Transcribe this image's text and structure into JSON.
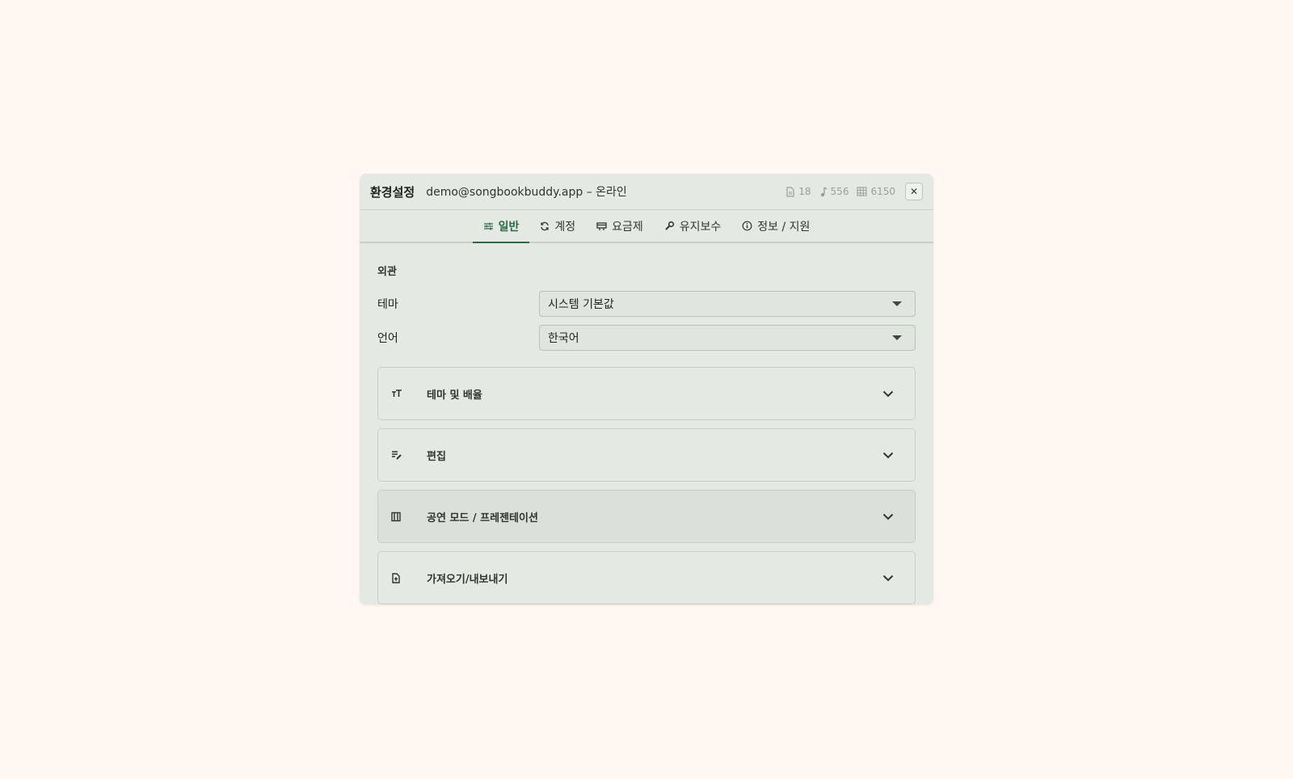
{
  "dialog": {
    "title": "환경설정",
    "subtitle": "demo@songbookbuddy.app – 온라인",
    "stats": [
      {
        "icon": "document-icon",
        "value": "18"
      },
      {
        "icon": "music-note-icon",
        "value": "556"
      },
      {
        "icon": "grid-icon",
        "value": "6150"
      }
    ],
    "close_label": "✕"
  },
  "tabs": [
    {
      "label": "일반",
      "icon": "sliders-icon",
      "active": true
    },
    {
      "label": "계정",
      "icon": "sync-icon",
      "active": false
    },
    {
      "label": "요금제",
      "icon": "billing-icon",
      "active": false
    },
    {
      "label": "유지보수",
      "icon": "wrench-icon",
      "active": false
    },
    {
      "label": "정보 / 지원",
      "icon": "info-icon",
      "active": false
    }
  ],
  "appearance": {
    "section_label": "외관",
    "theme_label": "테마",
    "theme_value": "시스템 기본값",
    "language_label": "언어",
    "language_value": "한국어"
  },
  "panels": [
    {
      "label": "테마 및 배율",
      "icon": "text-size-icon"
    },
    {
      "label": "편집",
      "icon": "edit-list-icon"
    },
    {
      "label": "공연 모드 / 프레젠테이션",
      "icon": "presentation-icon"
    },
    {
      "label": "가져오기/내보내기",
      "icon": "file-upload-icon"
    }
  ],
  "colors": {
    "accent": "#2a6b47",
    "background": "#fff8f2",
    "dialog": "#e4e9e3"
  }
}
